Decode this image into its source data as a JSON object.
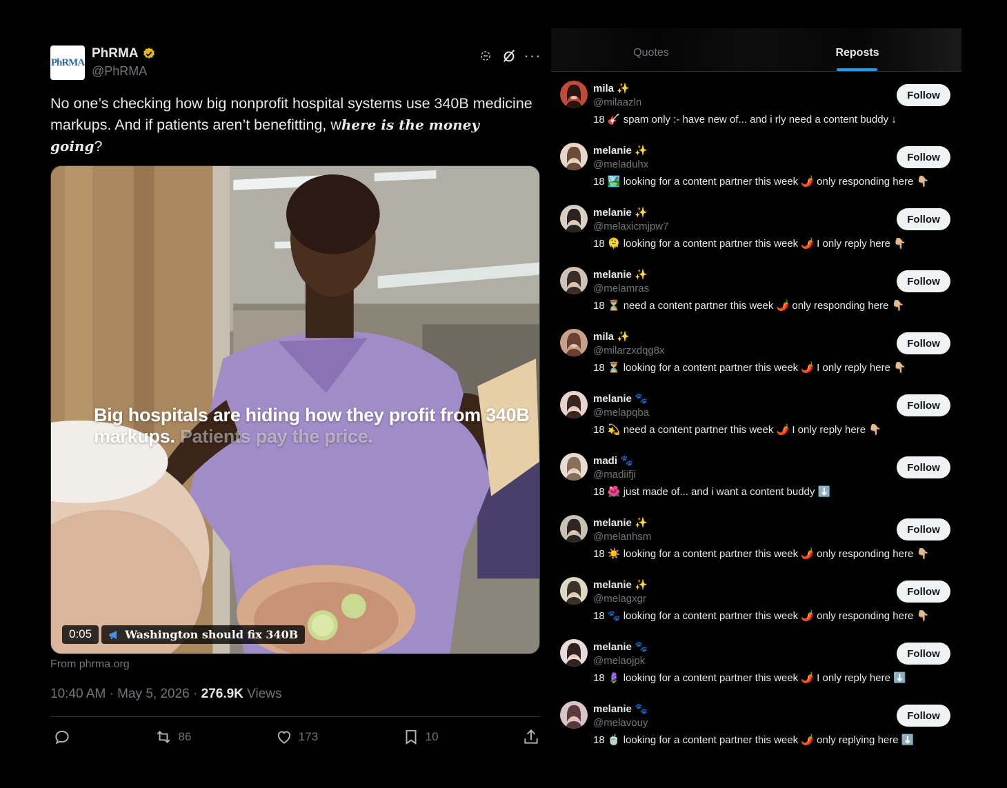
{
  "tweet": {
    "avatar_text": "PhRMA",
    "display_name": "PhRMA",
    "handle": "@PhRMA",
    "text_plain": "No one’s checking how big nonprofit hospital systems use 340B medicine markups. And if patients aren’t benefitting, w",
    "text_emphasis": "here is the money going",
    "text_end": "?",
    "video_caption_bold": "Big hospitals are hiding how they profit from 340B markups.",
    "video_caption_faded": "Patients pay the price.",
    "video_time": "0:05",
    "video_promo": "Washington should fix 340B",
    "source": "From phrma.org",
    "timestamp": "10:40 AM · May 5, 2026 · ",
    "views_count": "276.9K",
    "views_label": " Views",
    "reposts": "86",
    "likes": "173",
    "bookmarks": "10",
    "colors": {
      "verified": "#e2b719",
      "accent": "#1d9bf0"
    }
  },
  "panel": {
    "tabs": [
      {
        "label": "Quotes",
        "active": false
      },
      {
        "label": "Reposts",
        "active": true
      }
    ],
    "follow_label": "Follow",
    "users": [
      {
        "name": "mila ✨",
        "handle": "@milaazln",
        "bio": "18 🎸 spam only :- have new of... and i rly need a content buddy ↓"
      },
      {
        "name": "melanie ✨",
        "handle": "@meladuhx",
        "bio": "18 🏞️ looking for a content partner this week 🌶️ only responding here 👇🏼"
      },
      {
        "name": "melanie ✨",
        "handle": "@melaxicmjpw7",
        "bio": "18 🫠 looking for a content partner this week 🌶️ I only reply here 👇🏼"
      },
      {
        "name": "melanie ✨",
        "handle": "@melamras",
        "bio": "18 ⏳ need a content partner this week 🌶️ only responding here 👇🏼"
      },
      {
        "name": "mila ✨",
        "handle": "@milarzxdqg8x",
        "bio": "18 ⏳ looking for a content partner this week 🌶️ I only reply here 👇🏼"
      },
      {
        "name": "melanie 🐾",
        "handle": "@melapqba",
        "bio": "18 💫 need a content partner this week 🌶️ I only reply here 👇🏼"
      },
      {
        "name": "madi 🐾",
        "handle": "@madiifji",
        "bio": "18 🌺 just made of... and i want a content buddy ⬇️"
      },
      {
        "name": "melanie ✨",
        "handle": "@melanhsm",
        "bio": "18 ☀️ looking for a content partner this week 🌶️ only responding here 👇🏼"
      },
      {
        "name": "melanie ✨",
        "handle": "@melagxgr",
        "bio": "18 🐾 looking for a content partner this week 🌶️ only responding here 👇🏼"
      },
      {
        "name": "melanie 🐾",
        "handle": "@melaojpk",
        "bio": "18 🪻 looking for a content partner this week 🌶️ I only reply here ⬇️"
      },
      {
        "name": "melanie 🐾",
        "handle": "@melavouy",
        "bio": "18 🍵 looking for a content partner this week 🌶️ only replying here ⬇️"
      }
    ]
  }
}
